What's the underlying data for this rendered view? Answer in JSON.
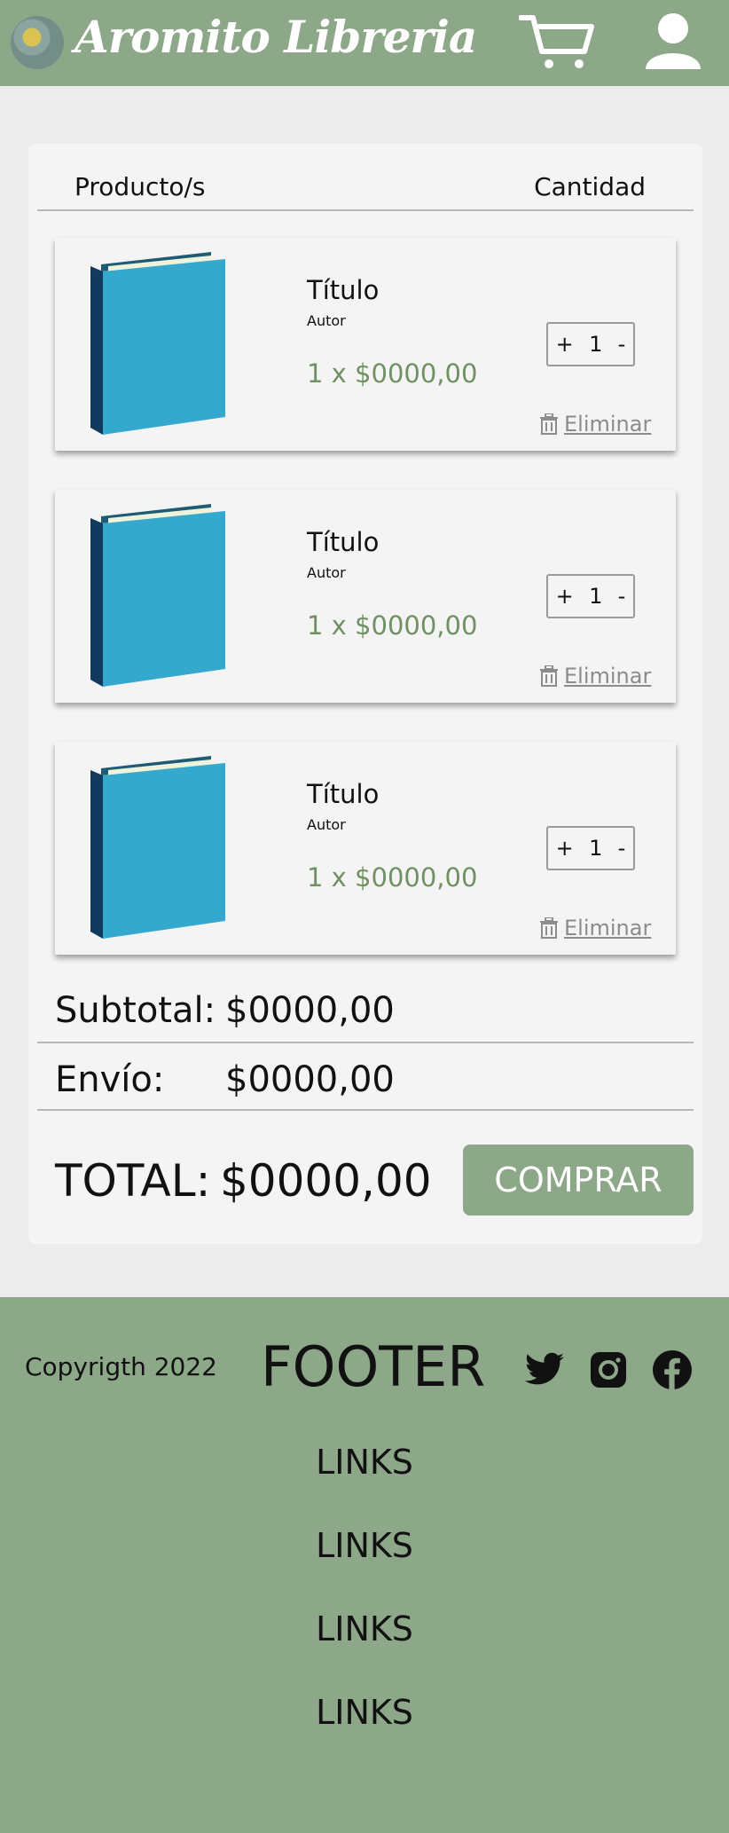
{
  "header": {
    "brand": "Aromito Libreria",
    "icons": {
      "logo": "flower-logo",
      "cart": "cart-icon",
      "user": "user-icon"
    }
  },
  "cart": {
    "col_producto": "Producto/s",
    "col_cantidad": "Cantidad",
    "items": [
      {
        "title": "Título",
        "author": "Autor",
        "price": "1 x $0000,00",
        "qty_plus": "+",
        "qty": "1",
        "qty_minus": "-",
        "delete": "Eliminar"
      },
      {
        "title": "Título",
        "author": "Autor",
        "price": "1 x $0000,00",
        "qty_plus": "+",
        "qty": "1",
        "qty_minus": "-",
        "delete": "Eliminar"
      },
      {
        "title": "Título",
        "author": "Autor",
        "price": "1 x $0000,00",
        "qty_plus": "+",
        "qty": "1",
        "qty_minus": "-",
        "delete": "Eliminar"
      }
    ],
    "subtotal_label": "Subtotal:",
    "subtotal_value": "$0000,00",
    "envio_label": "Envío:",
    "envio_value": "$0000,00",
    "total_label": "TOTAL:",
    "total_value": "$0000,00",
    "buy_label": "COMPRAR"
  },
  "footer": {
    "copyright": "Copyrigth 2022",
    "title": "FOOTER",
    "links": [
      "LINKS",
      "LINKS",
      "LINKS",
      "LINKS"
    ]
  },
  "colors": {
    "accent": "#8da888",
    "price": "#6f9163",
    "book": "#35a9cd"
  }
}
